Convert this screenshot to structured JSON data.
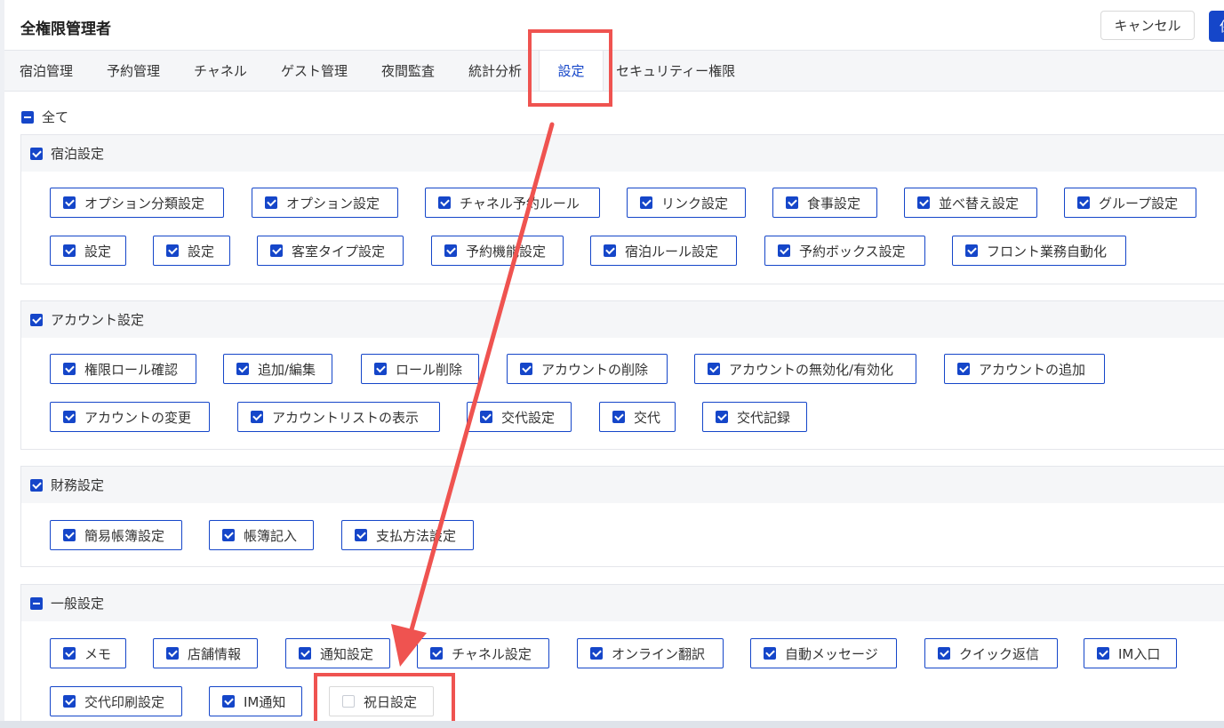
{
  "header": {
    "title": "全権限管理者",
    "cancel_label": "キャンセル",
    "confirm_label": "保"
  },
  "tabs": [
    {
      "label": "宿泊管理"
    },
    {
      "label": "予約管理"
    },
    {
      "label": "チャネル"
    },
    {
      "label": "ゲスト管理"
    },
    {
      "label": "夜間監査"
    },
    {
      "label": "統計分析"
    },
    {
      "label": "設定",
      "active": true
    },
    {
      "label": "セキュリティー権限"
    }
  ],
  "all_label": "全て",
  "sections": [
    {
      "title": "宿泊設定",
      "state": "checked",
      "items": [
        {
          "label": "オプション分類設定",
          "checked": true
        },
        {
          "label": "オプション設定",
          "checked": true
        },
        {
          "label": "チャネル予約ルール",
          "checked": true
        },
        {
          "label": "リンク設定",
          "checked": true
        },
        {
          "label": "食事設定",
          "checked": true
        },
        {
          "label": "並べ替え設定",
          "checked": true
        },
        {
          "label": "グループ設定",
          "checked": true
        },
        {
          "label": "設定",
          "checked": true
        },
        {
          "label": "設定",
          "checked": true
        },
        {
          "label": "客室タイプ設定",
          "checked": true
        },
        {
          "label": "予約機能設定",
          "checked": true
        },
        {
          "label": "宿泊ルール設定",
          "checked": true
        },
        {
          "label": "予約ボックス設定",
          "checked": true
        },
        {
          "label": "フロント業務自動化",
          "checked": true
        }
      ]
    },
    {
      "title": "アカウント設定",
      "state": "checked",
      "items": [
        {
          "label": "権限ロール確認",
          "checked": true
        },
        {
          "label": "追加/編集",
          "checked": true
        },
        {
          "label": "ロール削除",
          "checked": true
        },
        {
          "label": "アカウントの削除",
          "checked": true
        },
        {
          "label": "アカウントの無効化/有効化",
          "checked": true
        },
        {
          "label": "アカウントの追加",
          "checked": true
        },
        {
          "label": "アカウントの変更",
          "checked": true
        },
        {
          "label": "アカウントリストの表示",
          "checked": true
        },
        {
          "label": "交代設定",
          "checked": true
        },
        {
          "label": "交代",
          "checked": true
        },
        {
          "label": "交代記録",
          "checked": true
        }
      ]
    },
    {
      "title": "財務設定",
      "state": "checked",
      "items": [
        {
          "label": "簡易帳簿設定",
          "checked": true
        },
        {
          "label": "帳簿記入",
          "checked": true
        },
        {
          "label": "支払方法設定",
          "checked": true
        }
      ]
    },
    {
      "title": "一般設定",
      "state": "indeterminate",
      "items": [
        {
          "label": "メモ",
          "checked": true
        },
        {
          "label": "店舗情報",
          "checked": true
        },
        {
          "label": "通知設定",
          "checked": true
        },
        {
          "label": "チャネル設定",
          "checked": true
        },
        {
          "label": "オンライン翻訳",
          "checked": true
        },
        {
          "label": "自動メッセージ",
          "checked": true
        },
        {
          "label": "クイック返信",
          "checked": true
        },
        {
          "label": "IM入口",
          "checked": true
        },
        {
          "label": "交代印刷設定",
          "checked": true
        },
        {
          "label": "IM通知",
          "checked": true
        },
        {
          "label": "祝日設定",
          "checked": false
        }
      ]
    }
  ],
  "colors": {
    "primary": "#1546c9",
    "annotation": "#ef5350"
  }
}
